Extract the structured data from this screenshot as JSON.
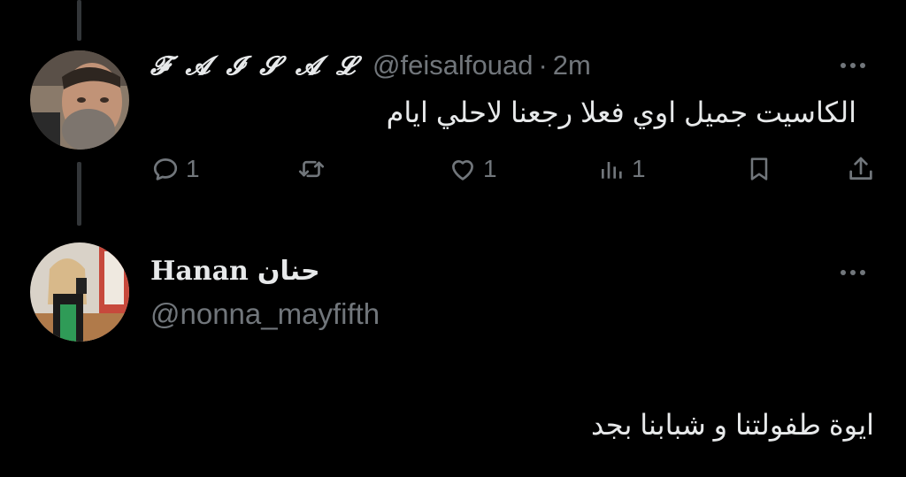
{
  "tweets": [
    {
      "display_name": "𝓕 𝓐 𝓘 𝓢 𝓐 𝓛",
      "handle": "@feisalfouad",
      "separator": "·",
      "time": "2m",
      "text": "الكاسيت جميل اوي فعلا رجعنا لاحلي ايام",
      "actions": {
        "replies": "1",
        "retweets": "",
        "likes": "1",
        "views": "1"
      }
    },
    {
      "display_name": "Hanan",
      "display_name_arabic": "حنان",
      "handle": "@nonna_mayfifth",
      "text": "ايوة طفولتنا و شبابنا بجد"
    }
  ],
  "colors": {
    "background": "#000000",
    "text_primary": "#e7e9ea",
    "text_secondary": "#71767b",
    "thread_line": "#333639"
  },
  "icons": {
    "reply": "reply-icon",
    "retweet": "retweet-icon",
    "like": "heart-icon",
    "views": "views-icon",
    "bookmark": "bookmark-icon",
    "share": "share-icon",
    "more": "more-icon"
  }
}
